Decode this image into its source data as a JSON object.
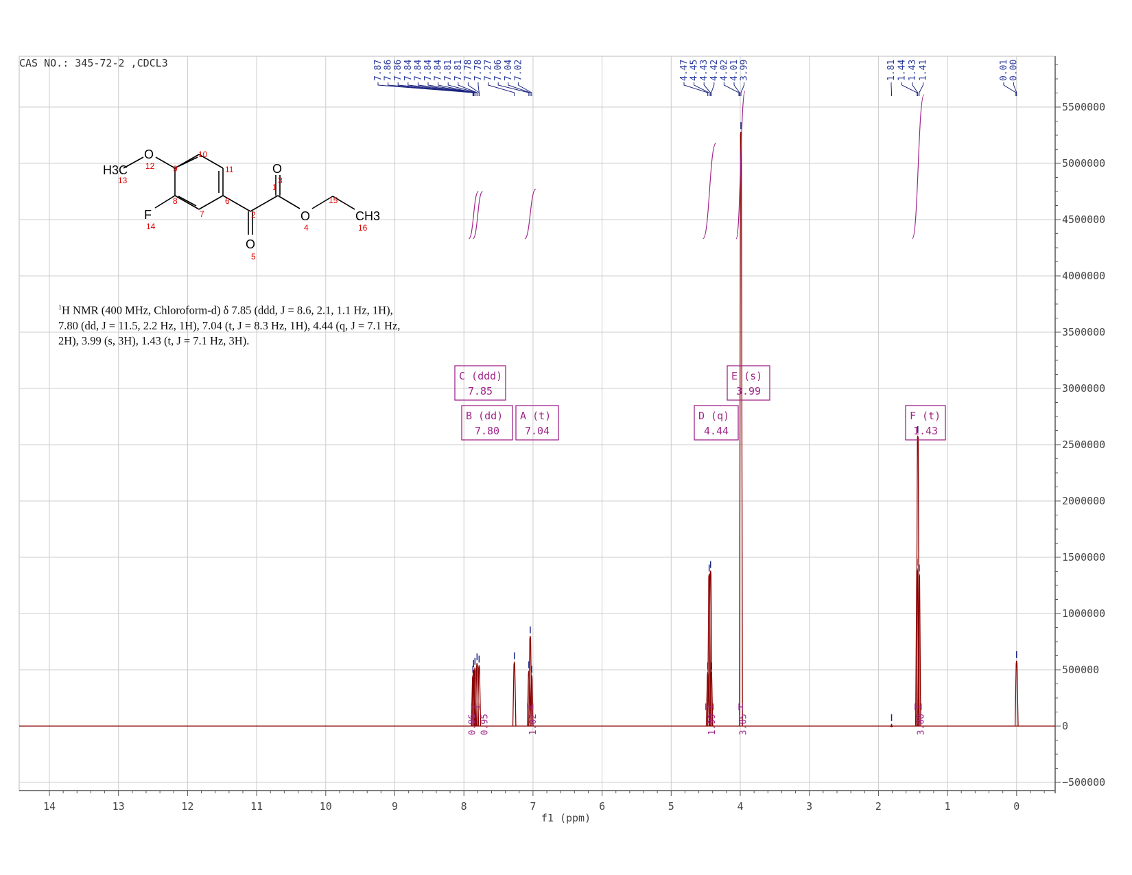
{
  "header": {
    "cas_label": "CAS NO.: 345-72-2 ,CDCL3"
  },
  "description": {
    "line1": "H NMR (400 MHz, Chloroform-d) δ 7.85 (ddd, J = 8.6, 2.1, 1.1 Hz, 1H),",
    "line2": "7.80 (dd, J = 11.5, 2.2 Hz, 1H), 7.04 (t, J = 8.3 Hz, 1H), 4.44 (q, J = 7.1 Hz,",
    "line3": "2H), 3.99 (s, 3H), 1.43 (t, J = 7.1 Hz, 3H).",
    "superscript": "1"
  },
  "molecule": {
    "atoms": {
      "O_methoxy": "O",
      "CH3_methoxy": "H3C",
      "F": "F",
      "O_ketone": "O",
      "O_ester_carbonyl": "O",
      "O_ester": "O",
      "CH3_ethyl": "CH3"
    },
    "numbers": [
      "1",
      "2",
      "3",
      "4",
      "5",
      "6",
      "7",
      "8",
      "9",
      "10",
      "11",
      "12",
      "13",
      "14",
      "15",
      "16"
    ]
  },
  "chart_data": {
    "type": "line",
    "title": "",
    "xlabel": "f1 (ppm)",
    "ylabel": "",
    "xlim": [
      14.5,
      -0.5
    ],
    "ylim": [
      -500000,
      5750000
    ],
    "x_ticks": [
      "14",
      "13",
      "12",
      "11",
      "10",
      "9",
      "8",
      "7",
      "6",
      "5",
      "4",
      "3",
      "2",
      "1",
      "0"
    ],
    "y_ticks": [
      "5500000",
      "5000000",
      "4500000",
      "4000000",
      "3500000",
      "3000000",
      "2500000",
      "2000000",
      "1500000",
      "1000000",
      "500000",
      "0",
      "-500000"
    ],
    "grid": true,
    "series": [
      {
        "peaks": [
          {
            "ppm": 7.87,
            "height": 450000
          },
          {
            "ppm": 7.86,
            "height": 500000
          },
          {
            "ppm": 7.84,
            "height": 520000
          },
          {
            "ppm": 7.81,
            "height": 560000
          },
          {
            "ppm": 7.78,
            "height": 540000
          },
          {
            "ppm": 7.27,
            "height": 570000
          },
          {
            "ppm": 7.06,
            "height": 490000
          },
          {
            "ppm": 7.04,
            "height": 800000
          },
          {
            "ppm": 7.02,
            "height": 450000
          },
          {
            "ppm": 4.47,
            "height": 480000
          },
          {
            "ppm": 4.45,
            "height": 1350000
          },
          {
            "ppm": 4.43,
            "height": 1380000
          },
          {
            "ppm": 4.42,
            "height": 480000
          },
          {
            "ppm": 3.99,
            "height": 5280000
          },
          {
            "ppm": 1.81,
            "height": 20000
          },
          {
            "ppm": 1.44,
            "height": 1400000
          },
          {
            "ppm": 1.43,
            "height": 2580000
          },
          {
            "ppm": 1.41,
            "height": 1350000
          },
          {
            "ppm": 0.0,
            "height": 580000
          }
        ]
      }
    ],
    "peak_labels": [
      "7.87",
      "7.86",
      "7.86",
      "7.84",
      "7.84",
      "7.84",
      "7.84",
      "7.81",
      "7.81",
      "7.78",
      "7.78",
      "7.27",
      "7.06",
      "7.04",
      "7.02",
      "4.47",
      "4.45",
      "4.43",
      "4.42",
      "4.02",
      "4.01",
      "3.99",
      "1.81",
      "1.44",
      "1.43",
      "1.41",
      "0.01",
      "0.00"
    ],
    "multiplets": [
      {
        "name": "C (ddd)",
        "shift": "7.85"
      },
      {
        "name": "B (dd)",
        "shift": "7.80"
      },
      {
        "name": "A (t)",
        "shift": "7.04"
      },
      {
        "name": "D (q)",
        "shift": "4.44"
      },
      {
        "name": "E (s)",
        "shift": "3.99"
      },
      {
        "name": "F (t)",
        "shift": "1.43"
      }
    ],
    "integrals": [
      {
        "from": 7.89,
        "to": 7.83,
        "value": "0.96"
      },
      {
        "from": 7.83,
        "to": 7.77,
        "value": "0.95"
      },
      {
        "from": 7.08,
        "to": 7.0,
        "value": "1.02"
      },
      {
        "from": 4.5,
        "to": 4.39,
        "value": "1.99"
      },
      {
        "from": 4.02,
        "to": 3.97,
        "value": "3.05"
      },
      {
        "from": 1.47,
        "to": 1.38,
        "value": "3.00"
      }
    ],
    "colors": {
      "spectrum": "#8b0000",
      "peak_label": "#2a3a9e",
      "peak_tick": "#1a237e",
      "integral": "#a0258a",
      "multiplet": "#a0258a",
      "grid": "#cccccc",
      "axis": "#555555"
    }
  }
}
